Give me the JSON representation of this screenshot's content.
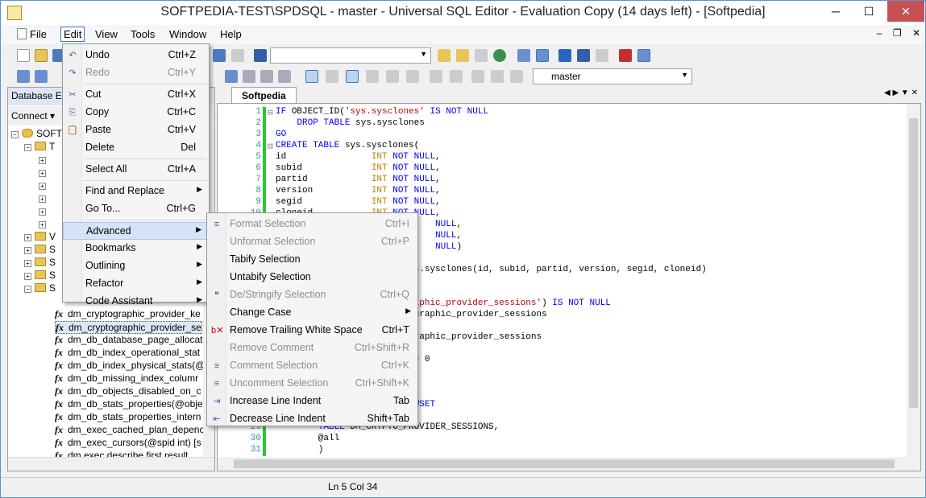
{
  "window": {
    "title": "SOFTPEDIA-TEST\\SPDSQL - master - Universal SQL Editor - Evaluation Copy (14 days left) - [Softpedia]",
    "min": "─",
    "max": "☐",
    "close": "✕"
  },
  "menubar": {
    "file": "File",
    "edit": "Edit",
    "view": "View",
    "tools": "Tools",
    "window": "Window",
    "help": "Help"
  },
  "mdi": {
    "min": "–",
    "restore": "❐",
    "close": "✕"
  },
  "toolbar": {
    "db_combo": "master"
  },
  "left_panel": {
    "header": "Database E",
    "connect": "Connect ▾",
    "tree_root": "SOFT",
    "folders": [
      "T",
      "V",
      "S",
      "S",
      "S",
      "S"
    ],
    "items": [
      "dm_cryptographic_provider_ke",
      "dm_cryptographic_provider_se",
      "dm_db_database_page_allocat",
      "dm_db_index_operational_stat",
      "dm_db_index_physical_stats(@",
      "dm_db_missing_index_columr",
      "dm_db_objects_disabled_on_c",
      "dm_db_stats_properties(@obje",
      "dm_db_stats_properties_intern",
      "dm_exec_cached_plan_depenc",
      "dm_exec_cursors(@spid int) [s",
      "dm exec describe first result"
    ]
  },
  "editor": {
    "tab": "Softpedia",
    "lines": [
      {
        "n": "1",
        "parts": [
          [
            "kw",
            "IF "
          ],
          [
            "",
            "OBJECT_ID("
          ],
          [
            "str",
            "'sys.sysclones'"
          ],
          [
            "",
            " "
          ],
          [
            "kw",
            "IS NOT NULL"
          ]
        ]
      },
      {
        "n": "2",
        "parts": [
          [
            "",
            "    "
          ],
          [
            "kw",
            "DROP TABLE "
          ],
          [
            "",
            "sys.sysclones"
          ]
        ]
      },
      {
        "n": "3",
        "parts": [
          [
            "kw",
            "GO"
          ]
        ]
      },
      {
        "n": "4",
        "parts": [
          [
            "kw",
            "CREATE TABLE "
          ],
          [
            "",
            "sys.sysclones("
          ]
        ]
      },
      {
        "n": "5",
        "parts": [
          [
            "",
            "id                "
          ],
          [
            "typ",
            "INT "
          ],
          [
            "kw",
            "NOT NULL"
          ],
          [
            "",
            ","
          ]
        ]
      },
      {
        "n": "6",
        "parts": [
          [
            "",
            "subid             "
          ],
          [
            "typ",
            "INT "
          ],
          [
            "kw",
            "NOT NULL"
          ],
          [
            "",
            ","
          ]
        ]
      },
      {
        "n": "7",
        "parts": [
          [
            "",
            "partid            "
          ],
          [
            "typ",
            "INT "
          ],
          [
            "kw",
            "NOT NULL"
          ],
          [
            "",
            ","
          ]
        ]
      },
      {
        "n": "8",
        "parts": [
          [
            "",
            "version           "
          ],
          [
            "typ",
            "INT "
          ],
          [
            "kw",
            "NOT NULL"
          ],
          [
            "",
            ","
          ]
        ]
      },
      {
        "n": "9",
        "parts": [
          [
            "",
            "segid             "
          ],
          [
            "typ",
            "INT "
          ],
          [
            "kw",
            "NOT NULL"
          ],
          [
            "",
            ","
          ]
        ]
      },
      {
        "n": "10",
        "parts": [
          [
            "",
            "cloneid           "
          ],
          [
            "typ",
            "INT "
          ],
          [
            "kw",
            "NOT NULL"
          ],
          [
            "",
            ","
          ]
        ]
      },
      {
        "n": "11",
        "parts": [
          [
            "",
            "                              "
          ],
          [
            "kw",
            "NULL"
          ],
          [
            "",
            ","
          ]
        ]
      },
      {
        "n": "12",
        "parts": [
          [
            "",
            "                              "
          ],
          [
            "kw",
            "NULL"
          ],
          [
            "",
            ","
          ]
        ]
      },
      {
        "n": "13",
        "parts": [
          [
            "",
            "                              "
          ],
          [
            "kw",
            "NULL"
          ],
          [
            "",
            ")"
          ]
        ]
      },
      {
        "n": "14",
        "parts": [
          [
            "",
            ""
          ]
        ]
      },
      {
        "n": "15",
        "parts": [
          [
            "",
            "                          s.sysclones(id, subid, partid, version, segid, cloneid)"
          ]
        ]
      },
      {
        "n": "16",
        "parts": [
          [
            "",
            ""
          ]
        ]
      },
      {
        "n": "17",
        "parts": [
          [
            "",
            ""
          ]
        ]
      },
      {
        "n": "18",
        "parts": [
          [
            "",
            "                          "
          ],
          [
            "str",
            "aphic_provider_sessions'"
          ],
          [
            "",
            ") "
          ],
          [
            "kw",
            "IS NOT NULL"
          ]
        ]
      },
      {
        "n": "19",
        "parts": [
          [
            "",
            "                          graphic_provider_sessions"
          ]
        ]
      },
      {
        "n": "20",
        "parts": [
          [
            "",
            ""
          ]
        ]
      },
      {
        "n": "21",
        "parts": [
          [
            "",
            "                          raphic_provider_sessions"
          ]
        ]
      },
      {
        "n": "22",
        "parts": [
          [
            "",
            ""
          ]
        ]
      },
      {
        "n": "23",
        "parts": [
          [
            "",
            "                          = 0"
          ]
        ]
      },
      {
        "n": "24",
        "parts": [
          [
            "",
            ""
          ]
        ]
      },
      {
        "n": "25",
        "parts": [
          [
            "",
            ""
          ]
        ]
      },
      {
        "n": "26",
        "parts": [
          [
            "",
            ""
          ]
        ]
      },
      {
        "n": "27",
        "parts": [
          [
            "",
            "                          "
          ],
          [
            "kw",
            "WSET"
          ]
        ]
      },
      {
        "n": "28",
        "parts": [
          [
            "",
            ""
          ]
        ]
      },
      {
        "n": "29",
        "parts": [
          [
            "",
            "        "
          ],
          [
            "kw",
            "TABLE "
          ],
          [
            "",
            "DM_CRYPTO_PROVIDER_SESSIONS,"
          ]
        ]
      },
      {
        "n": "30",
        "parts": [
          [
            "",
            "        @all"
          ]
        ]
      },
      {
        "n": "31",
        "parts": [
          [
            "",
            "        )"
          ]
        ]
      }
    ]
  },
  "edit_menu": [
    {
      "label": "Undo",
      "shortcut": "Ctrl+Z",
      "icon": "undo-icon",
      "disabled": false
    },
    {
      "label": "Redo",
      "shortcut": "Ctrl+Y",
      "icon": "redo-icon",
      "disabled": true
    },
    {
      "sep": true
    },
    {
      "label": "Cut",
      "shortcut": "Ctrl+X",
      "icon": "cut-icon",
      "disabled": false
    },
    {
      "label": "Copy",
      "shortcut": "Ctrl+C",
      "icon": "copy-icon",
      "disabled": false
    },
    {
      "label": "Paste",
      "shortcut": "Ctrl+V",
      "icon": "paste-icon",
      "disabled": false
    },
    {
      "label": "Delete",
      "shortcut": "Del",
      "icon": "",
      "disabled": false
    },
    {
      "sep": true
    },
    {
      "label": "Select All",
      "shortcut": "Ctrl+A",
      "icon": "",
      "disabled": false
    },
    {
      "sep": true
    },
    {
      "label": "Find and Replace",
      "shortcut": "",
      "submenu": true,
      "disabled": false
    },
    {
      "label": "Go To...",
      "shortcut": "Ctrl+G",
      "icon": "",
      "disabled": false
    },
    {
      "sep": true
    },
    {
      "label": "Advanced",
      "shortcut": "",
      "submenu": true,
      "disabled": false,
      "highlight": true
    },
    {
      "label": "Bookmarks",
      "shortcut": "",
      "submenu": true,
      "disabled": false
    },
    {
      "label": "Outlining",
      "shortcut": "",
      "submenu": true,
      "disabled": false
    },
    {
      "label": "Refactor",
      "shortcut": "",
      "submenu": true,
      "disabled": false
    },
    {
      "label": "Code Assistant",
      "shortcut": "",
      "submenu": true,
      "disabled": false
    }
  ],
  "advanced_menu": [
    {
      "label": "Format Selection",
      "shortcut": "Ctrl+I",
      "icon": "format-icon",
      "disabled": true
    },
    {
      "label": "Unformat Selection",
      "shortcut": "Ctrl+P",
      "icon": "",
      "disabled": true
    },
    {
      "label": "Tabify Selection",
      "shortcut": "",
      "icon": "",
      "disabled": false
    },
    {
      "label": "Untabify Selection",
      "shortcut": "",
      "icon": "",
      "disabled": false
    },
    {
      "label": "De/Stringify Selection",
      "shortcut": "Ctrl+Q",
      "icon": "stringify-icon",
      "disabled": true
    },
    {
      "label": "Change Case",
      "shortcut": "",
      "submenu": true,
      "disabled": false
    },
    {
      "label": "Remove Trailing White Space",
      "shortcut": "Ctrl+T",
      "icon": "whitespace-icon",
      "disabled": false
    },
    {
      "label": "Remove Comment",
      "shortcut": "Ctrl+Shift+R",
      "icon": "",
      "disabled": true
    },
    {
      "label": "Comment Selection",
      "shortcut": "Ctrl+K",
      "icon": "comment-icon",
      "disabled": true
    },
    {
      "label": "Uncomment Selection",
      "shortcut": "Ctrl+Shift+K",
      "icon": "uncomment-icon",
      "disabled": true
    },
    {
      "label": "Increase Line Indent",
      "shortcut": "Tab",
      "icon": "indent-icon",
      "disabled": false
    },
    {
      "label": "Decrease Line Indent",
      "shortcut": "Shift+Tab",
      "icon": "outdent-icon",
      "disabled": false
    }
  ],
  "status": {
    "position": "Ln 5  Col 34"
  },
  "colors": {
    "keyword": "#0000ff",
    "string": "#c00000",
    "type": "#c08000",
    "menu_highlight": "#d5e4f7"
  }
}
